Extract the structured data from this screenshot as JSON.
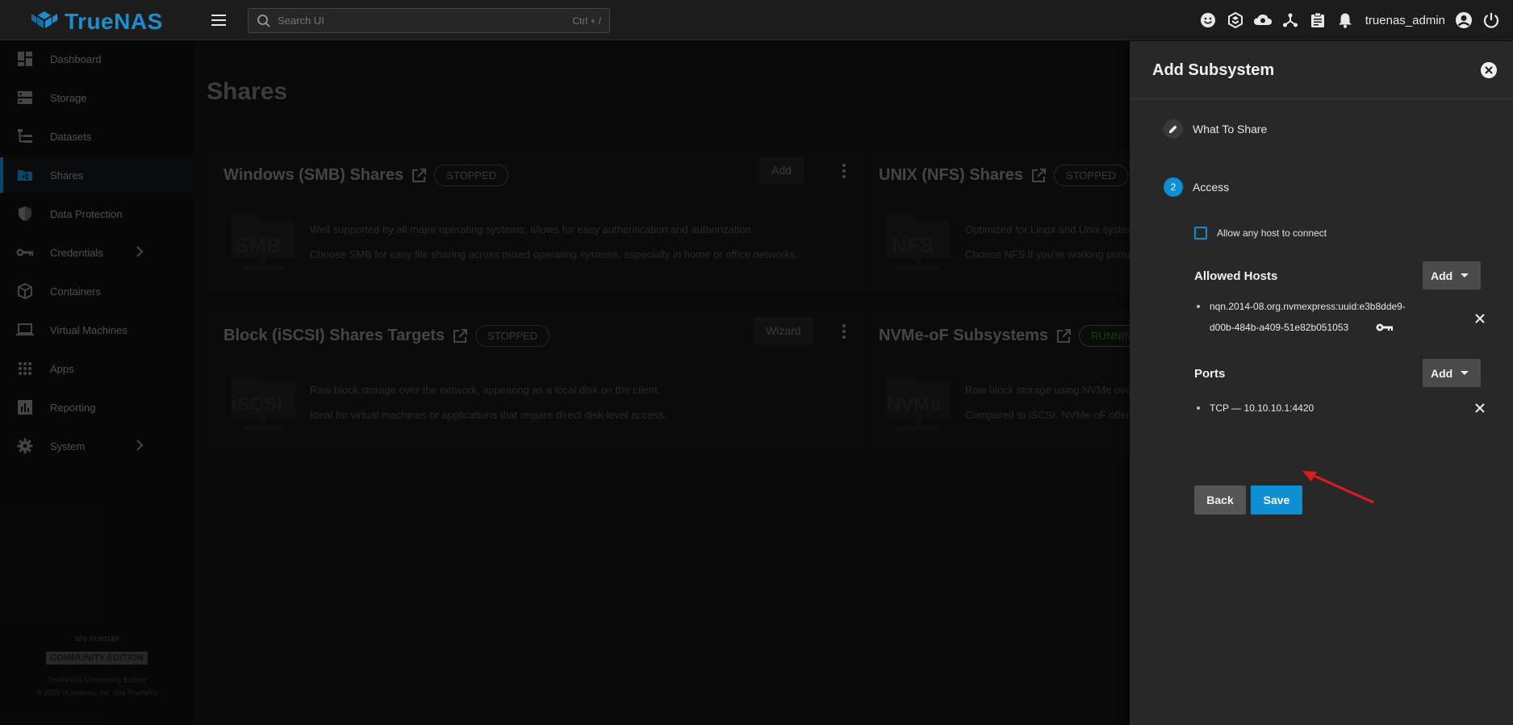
{
  "app": {
    "logo_text": "TrueNAS",
    "brand_color": "#1b8ecf",
    "accent_color": "#0e8fd4"
  },
  "topbar": {
    "search_placeholder": "Search UI",
    "search_shortcut": "Ctrl + /",
    "username": "truenas_admin",
    "icons": [
      "feedback-icon",
      "truecommand-icon",
      "directory-services-icon",
      "jobs-network-icon",
      "tasks-clipboard-icon",
      "alerts-bell-icon",
      "account-circle-icon",
      "power-icon"
    ]
  },
  "sidebar": {
    "items": [
      {
        "label": "Dashboard",
        "icon": "dashboard-icon"
      },
      {
        "label": "Storage",
        "icon": "storage-icon"
      },
      {
        "label": "Datasets",
        "icon": "datasets-icon"
      },
      {
        "label": "Shares",
        "icon": "shares-icon",
        "active": true
      },
      {
        "label": "Data Protection",
        "icon": "shield-icon"
      },
      {
        "label": "Credentials",
        "icon": "key-icon",
        "expandable": true
      },
      {
        "label": "Containers",
        "icon": "cube-icon"
      },
      {
        "label": "Virtual Machines",
        "icon": "laptop-icon"
      },
      {
        "label": "Apps",
        "icon": "apps-grid-icon"
      },
      {
        "label": "Reporting",
        "icon": "reporting-icon"
      },
      {
        "label": "System",
        "icon": "gear-icon",
        "expandable": true
      }
    ],
    "footer": {
      "hostname": "srv-truenas",
      "edition": "COMMUNITY EDITION",
      "copyright_line1": "TrueNAS® Community Edition",
      "copyright_line2": "© 2025 iXsystems, Inc. dba TrueNAS"
    }
  },
  "main": {
    "page_title": "Shares",
    "cards": [
      {
        "title": "Windows (SMB) Shares",
        "status": "STOPPED",
        "action": "Add",
        "icon_text": "SMB",
        "desc1": "Well supported by all major operating systems, allows for easy authentication and authorization.",
        "desc2": "Choose SMB for easy file sharing across mixed operating systems, especially in home or office networks."
      },
      {
        "title": "UNIX (NFS) Shares",
        "status": "STOPPED",
        "icon_text": "NFS",
        "desc1": "Optimized for Linux and Unix systems",
        "desc2": "Choose NFS if you're working primari"
      },
      {
        "title": "Block (iSCSI) Shares Targets",
        "status": "STOPPED",
        "action": "Wizard",
        "icon_text": "iSCSI",
        "desc1": "Raw block storage over the network, appearing as a local disk on the client.",
        "desc2": "Ideal for virtual machines or applications that require direct disk-level access."
      },
      {
        "title": "NVMe-oF Subsystems",
        "status": "RUNNIN",
        "icon_text": "NVMe",
        "desc1": "Raw block storage using NVMe over F",
        "desc2": "Compared to iSCSI, NVMe-oF offers s"
      }
    ]
  },
  "panel": {
    "title": "Add Subsystem",
    "steps": [
      {
        "label": "What To Share",
        "state": "done"
      },
      {
        "label": "Access",
        "number": "2",
        "state": "current"
      }
    ],
    "allow_any_host_label": "Allow any host to connect",
    "allowed_hosts": {
      "title": "Allowed Hosts",
      "add_label": "Add",
      "items": [
        {
          "line1": "nqn.2014-08.org.nvmexpress:uuid:e3b8dde9-",
          "line2": "d00b-484b-a409-51e82b051053"
        }
      ]
    },
    "ports": {
      "title": "Ports",
      "add_label": "Add",
      "items": [
        "TCP — 10.10.10.1:4420"
      ]
    },
    "back_label": "Back",
    "save_label": "Save"
  }
}
